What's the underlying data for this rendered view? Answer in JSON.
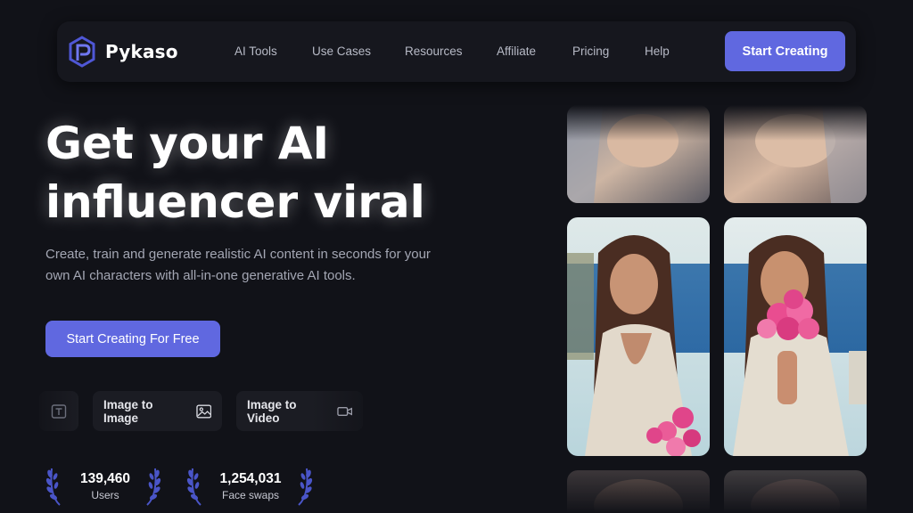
{
  "brand": {
    "name": "Pykaso"
  },
  "nav": {
    "links": [
      {
        "label": "AI Tools"
      },
      {
        "label": "Use Cases"
      },
      {
        "label": "Resources"
      },
      {
        "label": "Affiliate"
      },
      {
        "label": "Pricing"
      },
      {
        "label": "Help"
      }
    ],
    "cta_label": "Start Creating"
  },
  "hero": {
    "title_line1": "Get your AI",
    "title_line2": "influencer viral",
    "subtitle_line1": "Create, train and generate realistic AI content in seconds for your",
    "subtitle_line2": "own AI characters with all-in-one generative AI tools.",
    "cta_label": "Start Creating For Free"
  },
  "tools": [
    {
      "label": "",
      "icon": "text-icon"
    },
    {
      "label": "Image to Image",
      "icon": "image-icon"
    },
    {
      "label": "Image to Video",
      "icon": "video-icon"
    }
  ],
  "stats": [
    {
      "value": "139,460",
      "label": "Users"
    },
    {
      "value": "1,254,031",
      "label": "Face swaps"
    }
  ],
  "colors": {
    "background": "#111218",
    "accent": "#6068e0",
    "nav_bg": "#16171e",
    "laurel": "#4a55c8"
  }
}
